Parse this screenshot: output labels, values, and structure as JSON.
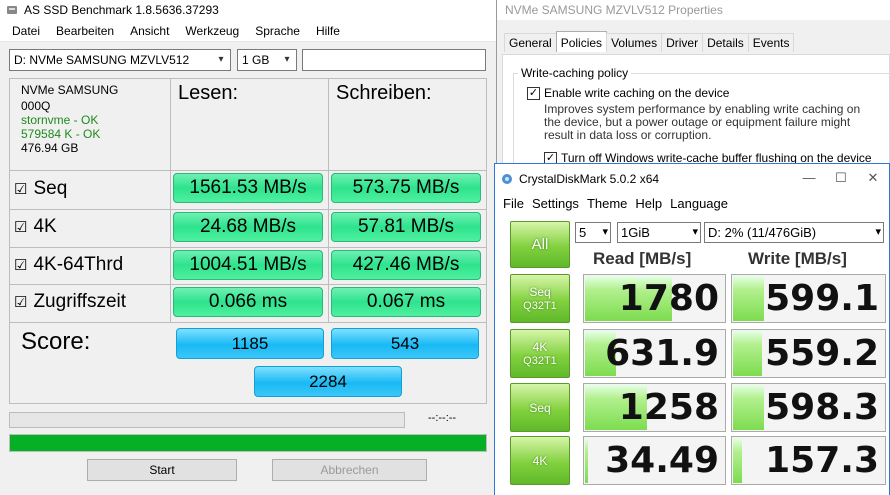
{
  "asssd": {
    "title": "AS SSD Benchmark 1.8.5636.37293",
    "menu": [
      "Datei",
      "Bearbeiten",
      "Ansicht",
      "Werkzeug",
      "Sprache",
      "Hilfe"
    ],
    "drive_select": "D: NVMe SAMSUNG MZVLV512",
    "size_select": "1 GB",
    "info": {
      "name": "NVMe SAMSUNG",
      "model": "000Q",
      "driver": "stornvme - OK",
      "align": "579584 K - OK",
      "capacity": "476.94 GB"
    },
    "headers": {
      "read": "Lesen:",
      "write": "Schreiben:"
    },
    "rows": [
      {
        "label": "Seq",
        "read": "1561.53 MB/s",
        "write": "573.75 MB/s"
      },
      {
        "label": "4K",
        "read": "24.68 MB/s",
        "write": "57.81 MB/s"
      },
      {
        "label": "4K-64Thrd",
        "read": "1004.51 MB/s",
        "write": "427.46 MB/s"
      },
      {
        "label": "Zugriffszeit",
        "read": "0.066 ms",
        "write": "0.067 ms"
      }
    ],
    "score_label": "Score:",
    "score": {
      "read": "1185",
      "write": "543",
      "total": "2284"
    },
    "time_display": "--:--:--",
    "progress_fraction": 1.0,
    "buttons": {
      "start": "Start",
      "abort": "Abbrechen"
    },
    "check_mark": "☑"
  },
  "props": {
    "title": "NVMe SAMSUNG MZVLV512 Properties",
    "tabs": [
      "General",
      "Policies",
      "Volumes",
      "Driver",
      "Details",
      "Events"
    ],
    "active_tab": "Policies",
    "group_title": "Write-caching policy",
    "opt1_label": "Enable write caching on the device",
    "opt1_desc": "Improves system performance by enabling write caching on the device, but a power outage or equipment failure might result in data loss or corruption.",
    "opt2_label": "Turn off Windows write-cache buffer flushing on the device",
    "check": "✓"
  },
  "cdm": {
    "title": "CrystalDiskMark 5.0.2 x64",
    "menu": [
      "File",
      "Settings",
      "Theme",
      "Help",
      "Language"
    ],
    "all_button": "All",
    "count_select": "5",
    "size_select": "1GiB",
    "drive_select": "D: 2% (11/476GiB)",
    "headers": {
      "read": "Read [MB/s]",
      "write": "Write [MB/s]"
    },
    "rows": [
      {
        "label1": "Seq",
        "label2": "Q32T1",
        "read": "1780",
        "write": "599.1",
        "read_frac": 0.62,
        "write_frac": 0.2
      },
      {
        "label1": "4K",
        "label2": "Q32T1",
        "read": "631.9",
        "write": "559.2",
        "read_frac": 0.22,
        "write_frac": 0.19
      },
      {
        "label1": "Seq",
        "label2": "",
        "read": "1258",
        "write": "598.3",
        "read_frac": 0.44,
        "write_frac": 0.2
      },
      {
        "label1": "4K",
        "label2": "",
        "read": "34.49",
        "write": "157.3",
        "read_frac": 0.02,
        "write_frac": 0.06
      }
    ],
    "controls": {
      "minimize": "—",
      "maximize": "☐",
      "close": "✕"
    }
  },
  "colors": {
    "asssd_green": "#2ee38d",
    "asssd_blue": "#19b9f5",
    "cdm_green": "#7ddc4f",
    "progress_green": "#06b025"
  }
}
